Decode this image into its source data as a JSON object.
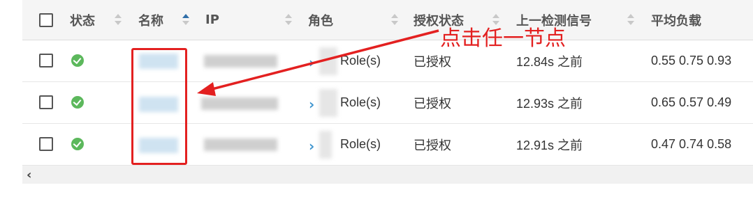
{
  "table": {
    "columns": [
      {
        "label": "状态"
      },
      {
        "label": "名称"
      },
      {
        "label": "IP"
      },
      {
        "label": "角色"
      },
      {
        "label": "授权状态"
      },
      {
        "label": "上一检测信号"
      },
      {
        "label": "平均负载"
      }
    ],
    "rows": [
      {
        "role": "Role(s)",
        "auth": "已授权",
        "heartbeat": "12.84s 之前",
        "load": "0.55  0.75  0.93"
      },
      {
        "role": "Role(s)",
        "auth": "已授权",
        "heartbeat": "12.93s 之前",
        "load": "0.65  0.57  0.49"
      },
      {
        "role": "Role(s)",
        "auth": "已授权",
        "heartbeat": "12.91s 之前",
        "load": "0.47  0.74  0.58"
      }
    ]
  },
  "annotation": {
    "text": "点击任一节点",
    "color": "#e32020"
  },
  "scroll": {
    "left_glyph": "‹"
  },
  "colors": {
    "status_ok": "#5cb85c",
    "link": "#3f95cf",
    "sort_active": "#2f6ea8"
  },
  "icons": {
    "status": "check-circle-icon",
    "expand": "chevron-right-icon"
  }
}
